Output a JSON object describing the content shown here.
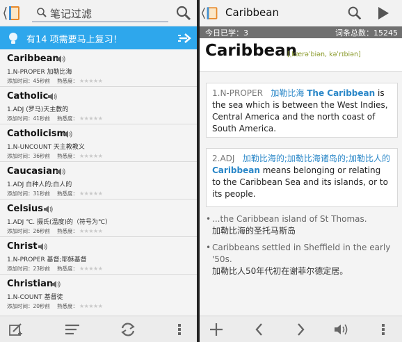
{
  "left_panel": {
    "search": {
      "placeholder": "笔记过滤"
    },
    "review_banner": {
      "text": "有14 项需要马上复习！"
    },
    "meta_labels": {
      "added_prefix": "添加时间：",
      "familiarity": "熟悉度："
    },
    "words": [
      {
        "word": "Caribbean",
        "definition": "1.N-PROPER 加勒比海",
        "added": "45秒前",
        "stars": "★★★★★"
      },
      {
        "word": "Catholic",
        "definition": "1.ADJ (罗马)天主教的",
        "added": "41秒前",
        "stars": "★★★★★"
      },
      {
        "word": "Catholicism",
        "definition": "1.N-UNCOUNT 天主教教义",
        "added": "36秒前",
        "stars": "★★★★★"
      },
      {
        "word": "Caucasian",
        "definition": "1.ADJ 白种人的;白人的",
        "added": "31秒前",
        "stars": "★★★★★"
      },
      {
        "word": "Celsius",
        "definition": "1.ADJ ℃. 摄氏(温度)的（符号为℃）",
        "added": "26秒前",
        "stars": "★★★★★"
      },
      {
        "word": "Christ",
        "definition": "1.N-PROPER 基督;耶稣基督",
        "added": "23秒前",
        "stars": "★★★★★"
      },
      {
        "word": "Christian",
        "definition": "1.N-COUNT 基督徒",
        "added": "20秒前",
        "stars": "★★★★★"
      }
    ],
    "toolbar": {
      "icons": [
        "edit-add-icon",
        "sort-lines-icon",
        "refresh-icon",
        "overflow-menu-icon"
      ]
    }
  },
  "right_panel": {
    "title": "Caribbean",
    "stats": {
      "today": "今日已学：3",
      "total": "词条总数：15245"
    },
    "headword": "Caribbean",
    "phonetic": "[ˌkærəˈbiən, kəˈrɪbiən]",
    "senses": [
      {
        "num": "1.N-PROPER",
        "zh": "加勒比海",
        "keyword": "The Caribbean",
        "text": "is the sea which is between the West Indies, Central America and the north coast of South America."
      },
      {
        "num": "2.ADJ",
        "zh": "加勒比海的;加勒比海诸岛的;加勒比人的",
        "keyword": "Caribbean",
        "text": "means belonging or relating to the Caribbean Sea and its islands, or to its people."
      }
    ],
    "examples": [
      {
        "bullet": "•",
        "en": "...the Caribbean island of St Thomas.",
        "zh": "加勒比海的圣托马斯岛"
      },
      {
        "bullet": "•",
        "en": "Caribbeans settled in Sheffield in the early '50s.",
        "zh": "加勒比人50年代初在谢菲尔德定居。"
      }
    ],
    "toolbar": {
      "icons": [
        "add-icon",
        "previous-icon",
        "next-icon",
        "speaker-icon",
        "overflow-menu-icon"
      ]
    }
  },
  "colors": {
    "accent_blue": "#2ea7ec",
    "stats_gray": "#707070",
    "phonetic_green": "#8a9a2a",
    "link_blue": "#2a87c8"
  }
}
